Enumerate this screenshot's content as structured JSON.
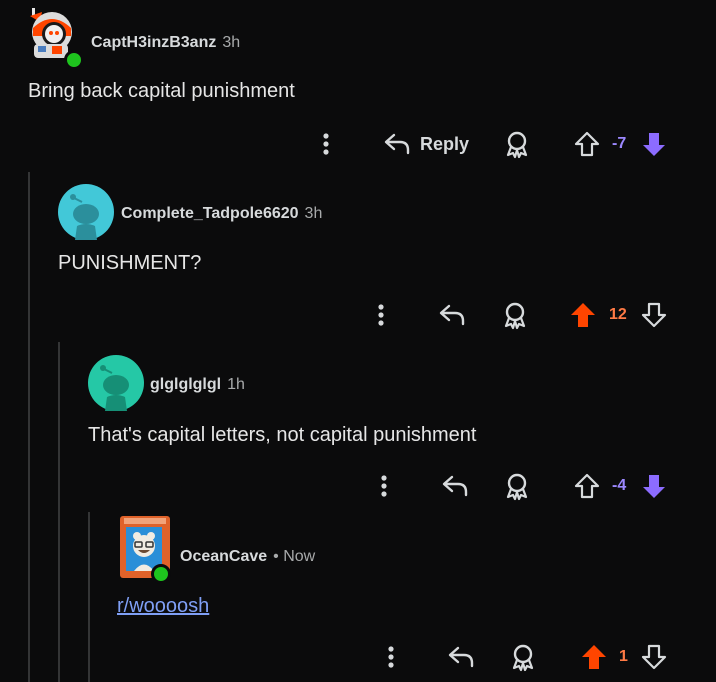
{
  "comments": [
    {
      "username": "CaptH3inzB3anz",
      "time": "3h",
      "text": "Bring back capital punishment",
      "score": "-7",
      "reply_label": "Reply",
      "vote": "down"
    },
    {
      "username": "Complete_Tadpole6620",
      "time": "3h",
      "text": "PUNISHMENT?",
      "score": "12",
      "vote": "up"
    },
    {
      "username": "glglglglgl",
      "time": "1h",
      "text": "That's capital letters, not capital punishment",
      "score": "-4",
      "vote": "down"
    },
    {
      "username": "OceanCave",
      "time": "• Now",
      "text": "r/woooosh",
      "score": "1",
      "vote": "up"
    }
  ],
  "colors": {
    "upvote": "#ff4500",
    "downvote": "#8c6cff",
    "upvote_score": "#ff7a45",
    "downvote_score": "#9c88ff",
    "link": "#7f9ff5",
    "online": "#1ec41e",
    "snoo_teal": "#42c8d8",
    "snoo_green": "#25c8a6"
  },
  "icons": [
    "more-options-icon",
    "reply-icon",
    "award-icon",
    "upvote-icon",
    "downvote-icon",
    "online-indicator"
  ]
}
